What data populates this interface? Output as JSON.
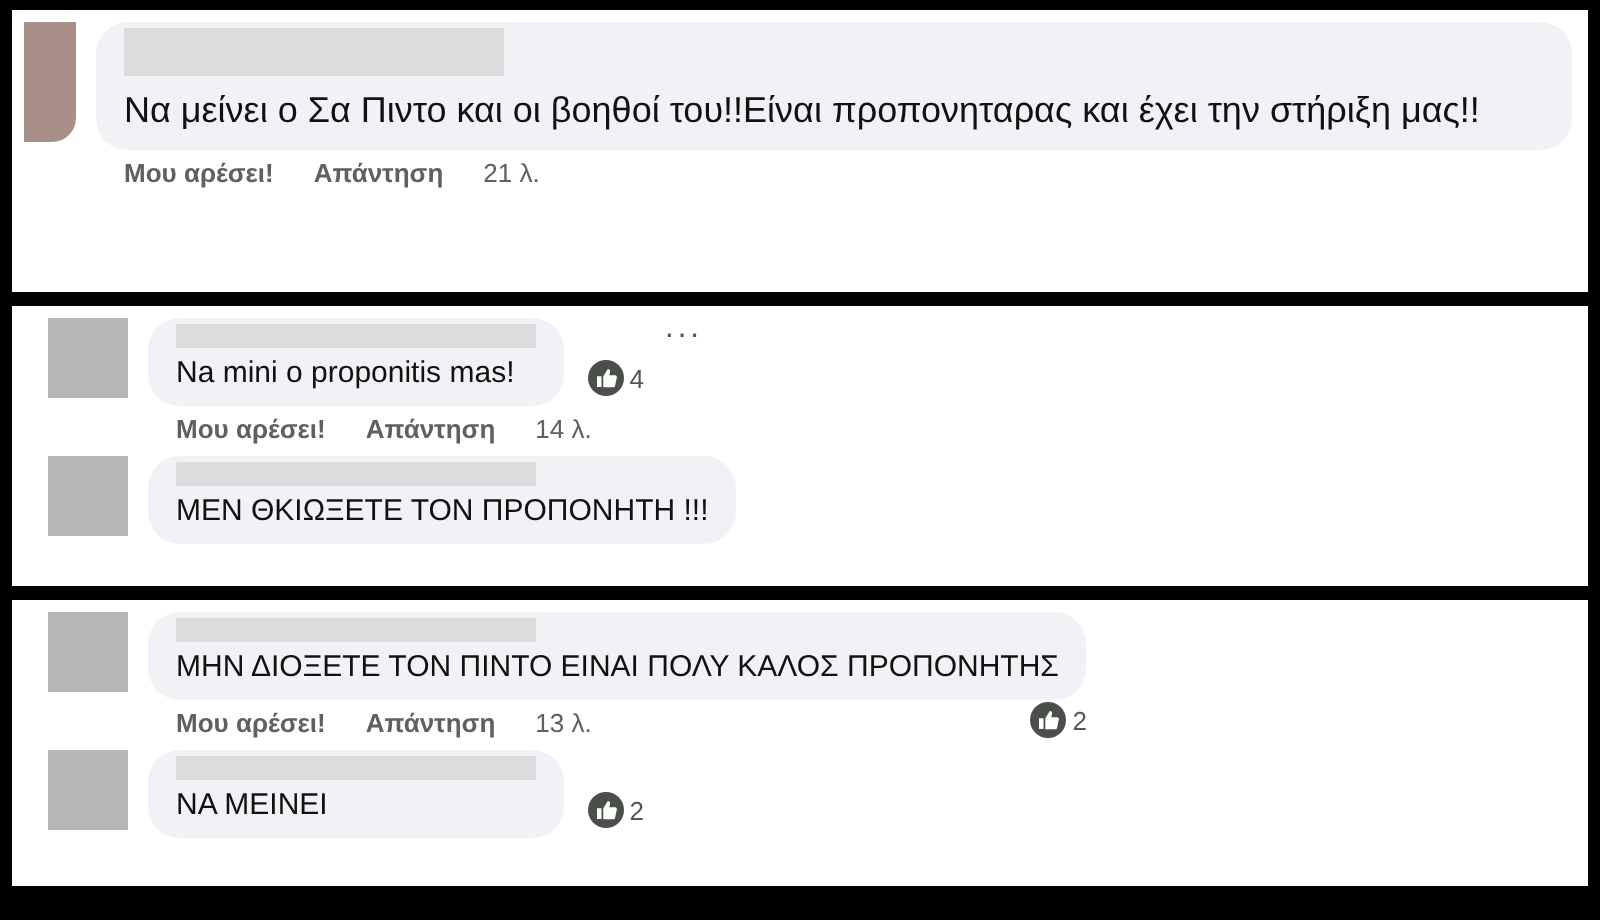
{
  "panels": [
    {
      "comments": [
        {
          "text": "Να μείνει ο Σα Πιντο και οι βοηθοί του!!Είναι προπονηταρας και έχει την στήριξη μας!!",
          "actions": {
            "like": "Μου αρέσει!",
            "reply": "Απάντηση",
            "time": "21 λ."
          }
        }
      ]
    },
    {
      "comments": [
        {
          "text": "Na mini o proponitis mas!",
          "reactions": "4",
          "more": "···",
          "actions": {
            "like": "Μου αρέσει!",
            "reply": "Απάντηση",
            "time": "14 λ."
          }
        },
        {
          "text": "ΜΕΝ ΘΚΙΩΞΕΤΕ ΤΟΝ ΠΡΟΠΟΝΗΤΗ !!!"
        }
      ]
    },
    {
      "comments": [
        {
          "text": "ΜΗΝ ΔΙΟΞΕΤΕ ΤΟΝ ΠΙΝΤΟ ΕΙΝΑΙ ΠΟΛΥ ΚΑΛΟΣ ΠΡΟΠΟΝΗΤΗΣ",
          "reactions": "2",
          "actions": {
            "like": "Μου αρέσει!",
            "reply": "Απάντηση",
            "time": "13 λ."
          }
        },
        {
          "text": "ΝΑ ΜΕΙΝΕΙ",
          "reactions": "2"
        }
      ]
    }
  ]
}
